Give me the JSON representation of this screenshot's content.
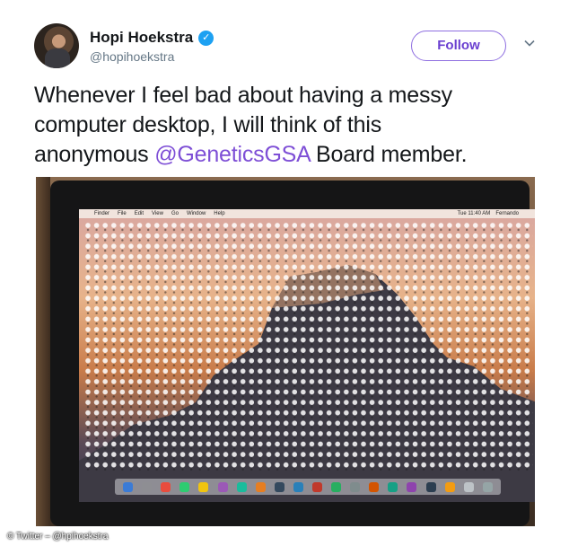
{
  "user": {
    "display_name": "Hopi Hoekstra",
    "handle": "@hopihoekstra",
    "verified_mark": "✓"
  },
  "follow_button_label": "Follow",
  "tweet": {
    "line1": "Whenever I feel bad about having a messy",
    "line2": "computer desktop,  I will think of this",
    "line3_prefix": "anonymous ",
    "mention": "@GeneticsGSA",
    "line3_suffix": " Board member."
  },
  "photo_screen": {
    "menu": {
      "apple": "",
      "items": [
        "Finder",
        "File",
        "Edit",
        "View",
        "Go",
        "Window",
        "Help"
      ],
      "clock": "Tue 11:40 AM",
      "user": "Fernando"
    }
  },
  "credit": "© Twitter – @hpihoekstra",
  "colors": {
    "mention": "#7e4fd6",
    "follow_border": "#8e6ee0",
    "verified": "#1da1f2",
    "handle": "#657786"
  },
  "icons": [
    "verified-badge-icon",
    "chevron-down-icon",
    "apple-icon"
  ]
}
